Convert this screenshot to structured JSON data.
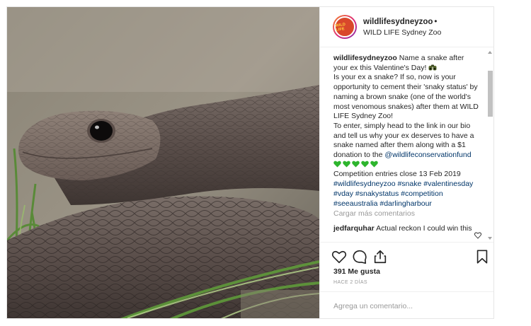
{
  "post": {
    "username": "wildlifesydneyzoo",
    "separator": "•",
    "location": "WILD LIFE Sydney Zoo",
    "avatar_text": "WILD LIFE",
    "caption": {
      "username": "wildlifesydneyzoo",
      "line1": "Name a snake after your ex this Valentine's Day!",
      "line2": "Is your ex a snake? If so, now is your opportunity to cement their 'snaky status' by naming a brown snake (one of the world's most venomous snakes) after them at WILD LIFE Sydney Zoo!",
      "line3": "To enter, simply head to the link in our bio and tell us why your ex deserves to have a snake named after them along with a $1 donation to the",
      "mention": "@wildlifeconservationfund",
      "line4": "Competition entries close 13 Feb 2019",
      "hashtags": "#wildlifesydneyzoo #snake #valentinesday #vday #snakystatus #competition #seeaustralia #darlingharbour"
    },
    "load_more": "Cargar más comentarios",
    "comment": {
      "username": "jedfarquhar",
      "text": "Actual reckon I could win this"
    },
    "likes": "391 Me gusta",
    "time": "HACE 2 DÍAS",
    "add_comment_placeholder": "Agrega un comentario...",
    "icons": {
      "like": "heart-outline-icon",
      "comment": "speech-bubble-icon",
      "share": "share-icon",
      "save": "bookmark-icon",
      "comment_like": "small-heart-icon"
    },
    "colors": {
      "link": "#003569",
      "muted": "#999999",
      "text": "#262626",
      "emoji_heart": "#2db52d"
    }
  }
}
